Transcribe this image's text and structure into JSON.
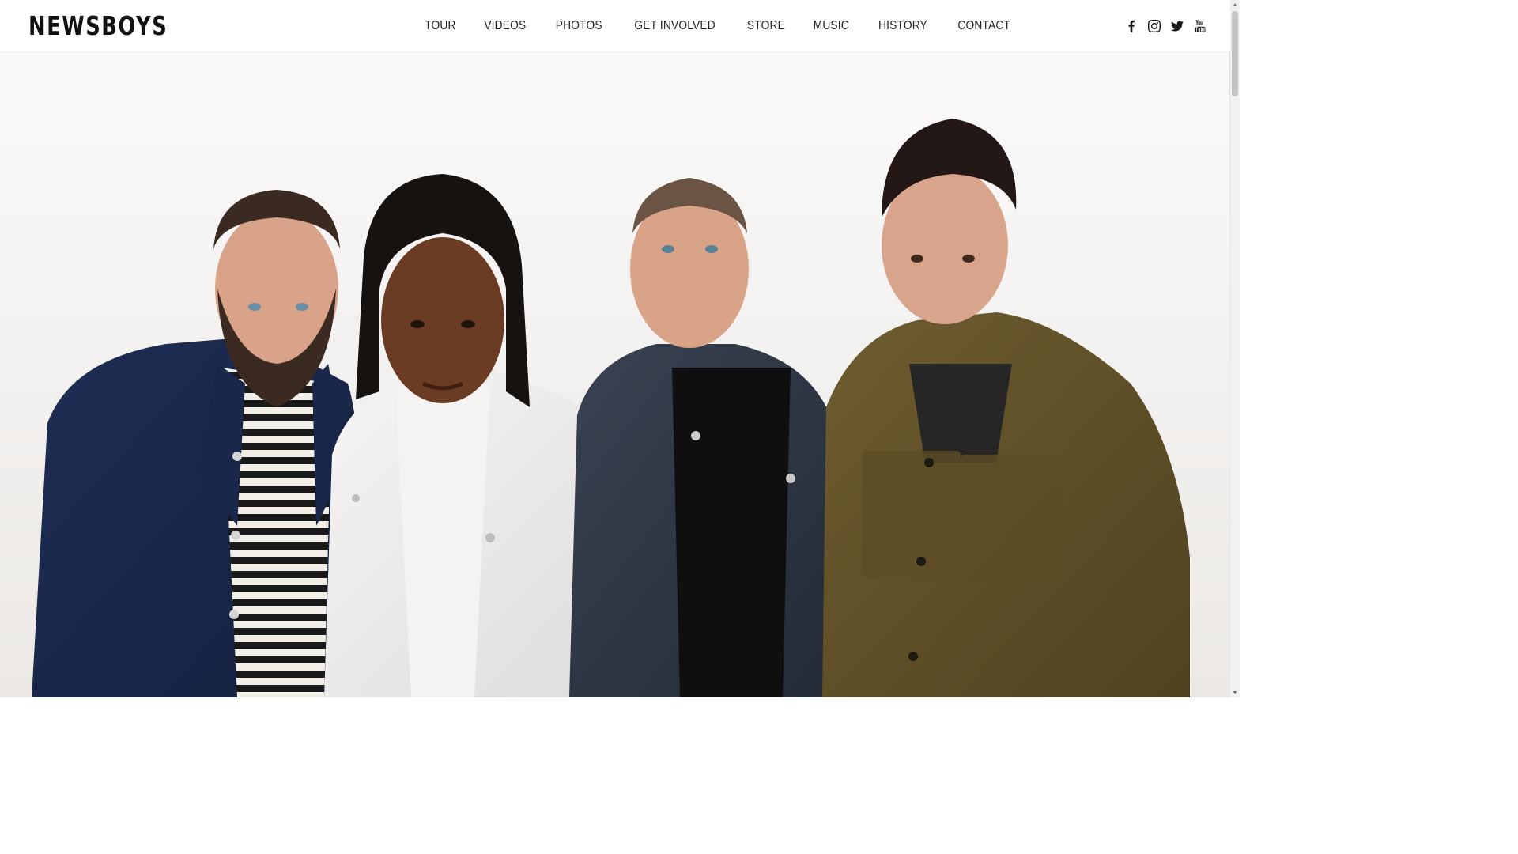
{
  "brand": {
    "logo_text": "NEWSBOYS"
  },
  "nav": {
    "items": [
      {
        "label": "TOUR"
      },
      {
        "label": "VIDEOS"
      },
      {
        "label": "PHOTOS"
      },
      {
        "label": "GET INVOLVED"
      },
      {
        "label": "STORE"
      },
      {
        "label": "MUSIC"
      },
      {
        "label": "HISTORY"
      },
      {
        "label": "CONTACT"
      }
    ]
  },
  "social": {
    "icons": [
      "facebook-icon",
      "instagram-icon",
      "twitter-icon",
      "youtube-icon"
    ]
  },
  "hero": {
    "image": "band-photo"
  },
  "colors": {
    "text": "#222222",
    "header_bg": "#ffffff",
    "hero_bg": "#f2f0ee"
  }
}
